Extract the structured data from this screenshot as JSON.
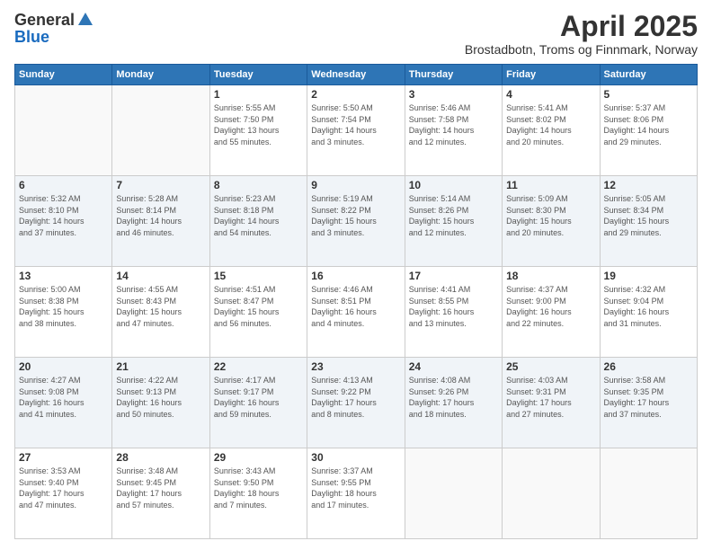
{
  "header": {
    "logo_general": "General",
    "logo_blue": "Blue",
    "month_title": "April 2025",
    "subtitle": "Brostadbotn, Troms og Finnmark, Norway"
  },
  "days_of_week": [
    "Sunday",
    "Monday",
    "Tuesday",
    "Wednesday",
    "Thursday",
    "Friday",
    "Saturday"
  ],
  "weeks": [
    [
      {
        "day": "",
        "info": ""
      },
      {
        "day": "",
        "info": ""
      },
      {
        "day": "1",
        "info": "Sunrise: 5:55 AM\nSunset: 7:50 PM\nDaylight: 13 hours\nand 55 minutes."
      },
      {
        "day": "2",
        "info": "Sunrise: 5:50 AM\nSunset: 7:54 PM\nDaylight: 14 hours\nand 3 minutes."
      },
      {
        "day": "3",
        "info": "Sunrise: 5:46 AM\nSunset: 7:58 PM\nDaylight: 14 hours\nand 12 minutes."
      },
      {
        "day": "4",
        "info": "Sunrise: 5:41 AM\nSunset: 8:02 PM\nDaylight: 14 hours\nand 20 minutes."
      },
      {
        "day": "5",
        "info": "Sunrise: 5:37 AM\nSunset: 8:06 PM\nDaylight: 14 hours\nand 29 minutes."
      }
    ],
    [
      {
        "day": "6",
        "info": "Sunrise: 5:32 AM\nSunset: 8:10 PM\nDaylight: 14 hours\nand 37 minutes."
      },
      {
        "day": "7",
        "info": "Sunrise: 5:28 AM\nSunset: 8:14 PM\nDaylight: 14 hours\nand 46 minutes."
      },
      {
        "day": "8",
        "info": "Sunrise: 5:23 AM\nSunset: 8:18 PM\nDaylight: 14 hours\nand 54 minutes."
      },
      {
        "day": "9",
        "info": "Sunrise: 5:19 AM\nSunset: 8:22 PM\nDaylight: 15 hours\nand 3 minutes."
      },
      {
        "day": "10",
        "info": "Sunrise: 5:14 AM\nSunset: 8:26 PM\nDaylight: 15 hours\nand 12 minutes."
      },
      {
        "day": "11",
        "info": "Sunrise: 5:09 AM\nSunset: 8:30 PM\nDaylight: 15 hours\nand 20 minutes."
      },
      {
        "day": "12",
        "info": "Sunrise: 5:05 AM\nSunset: 8:34 PM\nDaylight: 15 hours\nand 29 minutes."
      }
    ],
    [
      {
        "day": "13",
        "info": "Sunrise: 5:00 AM\nSunset: 8:38 PM\nDaylight: 15 hours\nand 38 minutes."
      },
      {
        "day": "14",
        "info": "Sunrise: 4:55 AM\nSunset: 8:43 PM\nDaylight: 15 hours\nand 47 minutes."
      },
      {
        "day": "15",
        "info": "Sunrise: 4:51 AM\nSunset: 8:47 PM\nDaylight: 15 hours\nand 56 minutes."
      },
      {
        "day": "16",
        "info": "Sunrise: 4:46 AM\nSunset: 8:51 PM\nDaylight: 16 hours\nand 4 minutes."
      },
      {
        "day": "17",
        "info": "Sunrise: 4:41 AM\nSunset: 8:55 PM\nDaylight: 16 hours\nand 13 minutes."
      },
      {
        "day": "18",
        "info": "Sunrise: 4:37 AM\nSunset: 9:00 PM\nDaylight: 16 hours\nand 22 minutes."
      },
      {
        "day": "19",
        "info": "Sunrise: 4:32 AM\nSunset: 9:04 PM\nDaylight: 16 hours\nand 31 minutes."
      }
    ],
    [
      {
        "day": "20",
        "info": "Sunrise: 4:27 AM\nSunset: 9:08 PM\nDaylight: 16 hours\nand 41 minutes."
      },
      {
        "day": "21",
        "info": "Sunrise: 4:22 AM\nSunset: 9:13 PM\nDaylight: 16 hours\nand 50 minutes."
      },
      {
        "day": "22",
        "info": "Sunrise: 4:17 AM\nSunset: 9:17 PM\nDaylight: 16 hours\nand 59 minutes."
      },
      {
        "day": "23",
        "info": "Sunrise: 4:13 AM\nSunset: 9:22 PM\nDaylight: 17 hours\nand 8 minutes."
      },
      {
        "day": "24",
        "info": "Sunrise: 4:08 AM\nSunset: 9:26 PM\nDaylight: 17 hours\nand 18 minutes."
      },
      {
        "day": "25",
        "info": "Sunrise: 4:03 AM\nSunset: 9:31 PM\nDaylight: 17 hours\nand 27 minutes."
      },
      {
        "day": "26",
        "info": "Sunrise: 3:58 AM\nSunset: 9:35 PM\nDaylight: 17 hours\nand 37 minutes."
      }
    ],
    [
      {
        "day": "27",
        "info": "Sunrise: 3:53 AM\nSunset: 9:40 PM\nDaylight: 17 hours\nand 47 minutes."
      },
      {
        "day": "28",
        "info": "Sunrise: 3:48 AM\nSunset: 9:45 PM\nDaylight: 17 hours\nand 57 minutes."
      },
      {
        "day": "29",
        "info": "Sunrise: 3:43 AM\nSunset: 9:50 PM\nDaylight: 18 hours\nand 7 minutes."
      },
      {
        "day": "30",
        "info": "Sunrise: 3:37 AM\nSunset: 9:55 PM\nDaylight: 18 hours\nand 17 minutes."
      },
      {
        "day": "",
        "info": ""
      },
      {
        "day": "",
        "info": ""
      },
      {
        "day": "",
        "info": ""
      }
    ]
  ]
}
